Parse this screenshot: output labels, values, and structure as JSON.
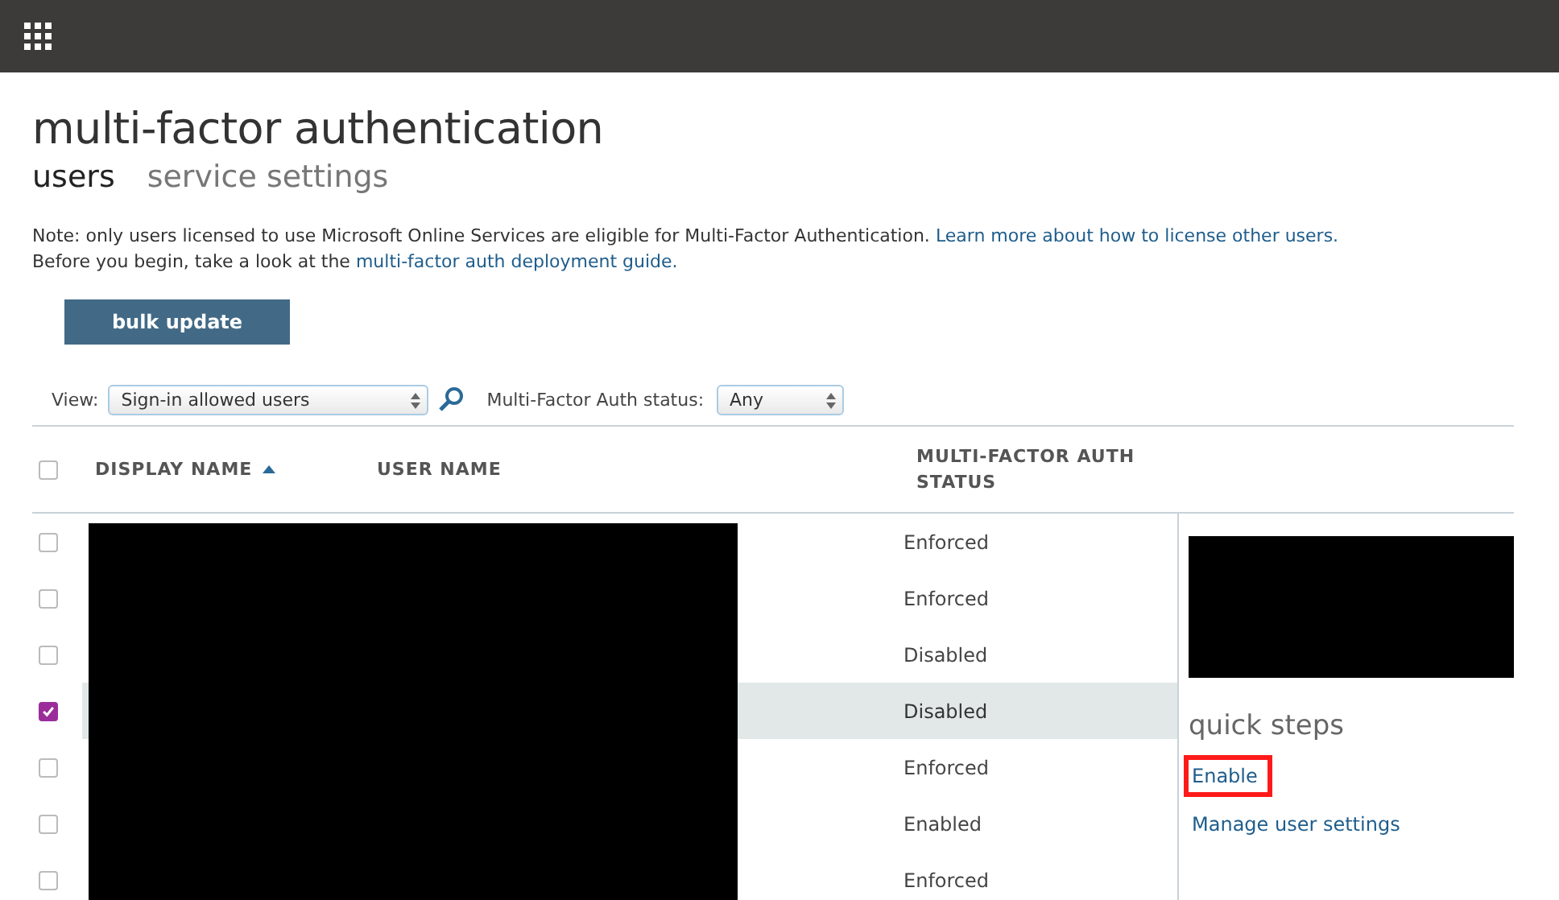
{
  "title": "multi-factor authentication",
  "tabs": [
    {
      "label": "users",
      "selected": true
    },
    {
      "label": "service settings",
      "selected": false
    }
  ],
  "note": {
    "lines": [
      {
        "text": "Note: only users licensed to use Microsoft Online Services are eligible for Multi-Factor Authentication.",
        "link": "Learn more about how to license other users."
      },
      {
        "text": "Before you begin, take a look at the",
        "link": "multi-factor auth deployment guide."
      }
    ]
  },
  "bulk_update_button": "bulk update",
  "filters": {
    "view_label": "View:",
    "view_value": "Sign-in allowed users",
    "status_label": "Multi-Factor Auth status:",
    "status_value": "Any"
  },
  "table": {
    "columns": [
      {
        "label": "DISPLAY NAME",
        "sorted": true
      },
      {
        "label": "USER NAME",
        "sorted": false
      },
      {
        "label": "MULTI-FACTOR AUTH STATUS",
        "sorted": false
      }
    ],
    "select_all_checked": false,
    "rows": [
      {
        "status": "Enforced",
        "checked": false,
        "selected": false
      },
      {
        "status": "Enforced",
        "checked": false,
        "selected": false
      },
      {
        "status": "Disabled",
        "checked": false,
        "selected": false
      },
      {
        "status": "Disabled",
        "checked": true,
        "selected": true
      },
      {
        "status": "Enforced",
        "checked": false,
        "selected": false
      },
      {
        "status": "Enabled",
        "checked": false,
        "selected": false
      },
      {
        "status": "Enforced",
        "checked": false,
        "selected": false
      }
    ]
  },
  "side_panel": {
    "heading": "quick steps",
    "links": [
      {
        "label": "Enable",
        "highlighted": true
      },
      {
        "label": "Manage user settings",
        "highlighted": false
      }
    ]
  }
}
